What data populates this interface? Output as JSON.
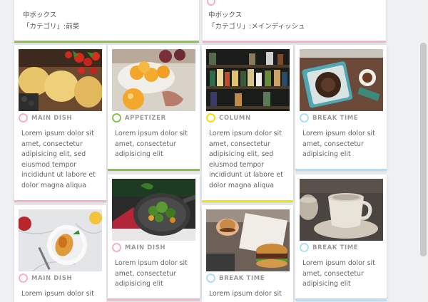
{
  "top_cards": [
    {
      "category": "APPETIZER",
      "line1": "中ボックス",
      "line2": "「カテゴリ」:前菜",
      "color": "#8cc152"
    },
    {
      "category": "MAIN DISH",
      "line1": "中ボックス",
      "line2": "「カテゴリ」:メインディッシュ",
      "color": "#f7b1c7"
    }
  ],
  "cards": [
    {
      "category": "MAIN DISH",
      "text": "Lorem ipsum dolor sit amet, consectetur adipisicing elit, sed eiusmod tempor incididunt ut labore et dolor magna aliqua",
      "color": "#f7b1c7",
      "image": "pasta"
    },
    {
      "category": "APPETIZER",
      "text": "Lorem ipsum dolor sit amet, consectetur adipisicing elit",
      "color": "#8cc152",
      "image": "fruit"
    },
    {
      "category": "COLUMN",
      "text": "Lorem ipsum dolor sit amet, consectetur adipisicing elit, sed eiusmod tempor incididunt ut labore et dolor magna aliqua",
      "color": "#f5e400",
      "image": "shelf"
    },
    {
      "category": "BREAK TIME",
      "text": "Lorem ipsum dolor sit amet, consectetur adipisicing elit",
      "color": "#aee0f5",
      "image": "coffee-top"
    },
    {
      "category": "MAIN DISH",
      "text": "Lorem ipsum dolor sit amet, consectetur adipisicing elit",
      "color": "#f7b1c7",
      "image": "pan"
    },
    {
      "category": "BREAK TIME",
      "text": "Lorem ipsum dolor sit amet, consectetur adipisicing elit",
      "color": "#aee0f5",
      "image": "cup"
    },
    {
      "category": "MAIN DISH",
      "text": "Lorem ipsum dolor sit",
      "color": "#f7b1c7",
      "image": "plate"
    },
    {
      "category": "BREAK TIME",
      "text": "Lorem ipsum dolor sit",
      "color": "#aee0f5",
      "image": "burger"
    }
  ]
}
